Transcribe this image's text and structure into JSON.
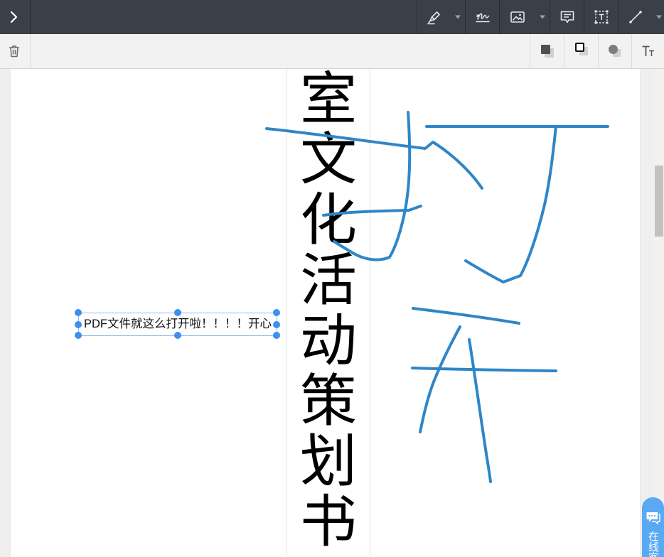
{
  "toolbar": {
    "expand_icon": "chevron-right-icon",
    "tools": [
      {
        "icon": "pen-icon",
        "dropdown_icon": "caret-down-icon"
      },
      {
        "icon": "signature-icon"
      },
      {
        "icon": "image-icon",
        "dropdown_icon": "caret-down-icon"
      },
      {
        "icon": "comment-icon"
      },
      {
        "icon": "textbox-icon"
      },
      {
        "icon": "line-icon",
        "dropdown_icon": "caret-down-icon"
      }
    ]
  },
  "property_bar": {
    "delete_icon": "trash-icon",
    "properties": [
      {
        "icon": "fill-color-icon"
      },
      {
        "icon": "stroke-color-icon"
      },
      {
        "icon": "opacity-icon"
      },
      {
        "icon": "text-size-icon"
      }
    ]
  },
  "document": {
    "title_chars": [
      "室",
      "文",
      "化",
      "活",
      "动",
      "策",
      "划",
      "书"
    ],
    "text_annotation": {
      "text": "PDF文件就这么打开啦！！！！开心",
      "selected": true
    },
    "ink_annotation": {
      "color": "#2e86c8"
    }
  },
  "chat_widget": {
    "icon": "chat-bubble-icon",
    "label": "在线客"
  },
  "colors": {
    "toolbar_bg": "#3a4048",
    "property_bar_bg": "#f2f2f2",
    "page_bg": "#ffffff",
    "selection_accent": "#3d8ff0",
    "chat_widget_bg": "#59a9f5"
  }
}
